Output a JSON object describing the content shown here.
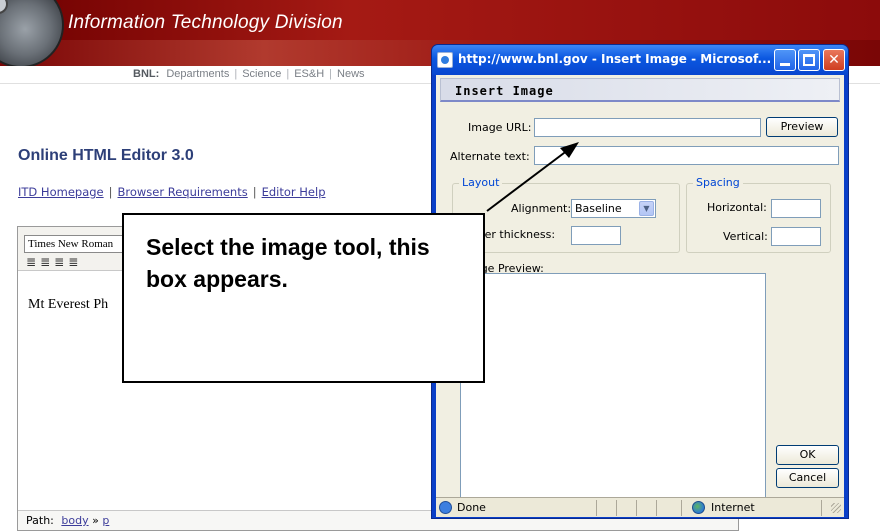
{
  "site": {
    "title": "Information Technology Division",
    "nav": {
      "prefix": "BNL:",
      "items": [
        "Departments",
        "Science",
        "ES&H",
        "News"
      ]
    }
  },
  "editor": {
    "title": "Online HTML Editor 3.0",
    "links": [
      "ITD Homepage",
      "Browser Requirements",
      "Editor Help"
    ],
    "font_value": "Times New Roman",
    "content": "Mt Everest Ph",
    "path_label": "Path:",
    "path_items": [
      "body",
      "p"
    ],
    "path_separator": "»"
  },
  "dialog": {
    "window_title": "http://www.bnl.gov - Insert Image - Microsof...",
    "heading": "Insert Image",
    "image_url_label": "Image URL:",
    "image_url_value": "",
    "preview_button": "Preview",
    "alt_text_label": "Alternate text:",
    "alt_text_value": "",
    "layout_legend": "Layout",
    "alignment_label": "Alignment:",
    "alignment_value": "Baseline",
    "border_label": "Border thickness:",
    "border_value": "",
    "spacing_legend": "Spacing",
    "horizontal_label": "Horizontal:",
    "horizontal_value": "",
    "vertical_label": "Vertical:",
    "vertical_value": "",
    "image_preview_label": "Image Preview:",
    "ok_button": "OK",
    "cancel_button": "Cancel",
    "status_done": "Done",
    "status_zone": "Internet"
  },
  "callout": {
    "text": "Select the image tool, this box appears."
  }
}
